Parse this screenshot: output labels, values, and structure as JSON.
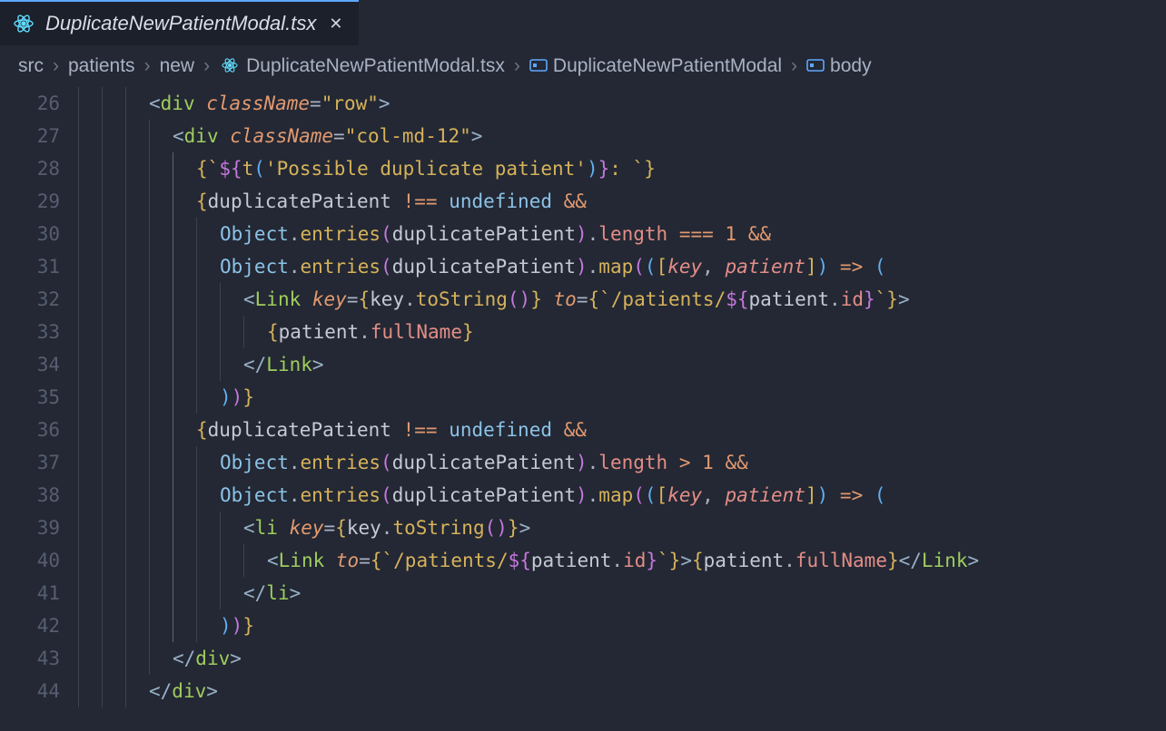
{
  "tab": {
    "title": "DuplicateNewPatientModal.tsx"
  },
  "breadcrumb": {
    "src": "src",
    "patients": "patients",
    "new": "new",
    "file": "DuplicateNewPatientModal.tsx",
    "component": "DuplicateNewPatientModal",
    "symbol": "body"
  },
  "gutter": {
    "start": 26,
    "end": 44
  },
  "code": {
    "lines": [
      {
        "n": 26,
        "indent": 3,
        "tokens": [
          {
            "t": "<",
            "c": "tagp"
          },
          {
            "t": "div",
            "c": "tag"
          },
          {
            "t": " "
          },
          {
            "t": "className",
            "c": "attr"
          },
          {
            "t": "=",
            "c": "pun"
          },
          {
            "t": "\"row\"",
            "c": "str"
          },
          {
            "t": ">",
            "c": "tagp"
          }
        ]
      },
      {
        "n": 27,
        "indent": 4,
        "tokens": [
          {
            "t": "<",
            "c": "tagp"
          },
          {
            "t": "div",
            "c": "tag"
          },
          {
            "t": " "
          },
          {
            "t": "className",
            "c": "attr"
          },
          {
            "t": "=",
            "c": "pun"
          },
          {
            "t": "\"col-md-12\"",
            "c": "str"
          },
          {
            "t": ">",
            "c": "tagp"
          }
        ]
      },
      {
        "n": 28,
        "indent": 5,
        "tokens": [
          {
            "t": "{",
            "c": "brace-y"
          },
          {
            "t": "`",
            "c": "tick"
          },
          {
            "t": "${",
            "c": "brace-p"
          },
          {
            "t": "t",
            "c": "call"
          },
          {
            "t": "(",
            "c": "brace-b"
          },
          {
            "t": "'Possible duplicate patient'",
            "c": "str"
          },
          {
            "t": ")",
            "c": "brace-b"
          },
          {
            "t": "}",
            "c": "brace-p"
          },
          {
            "t": ": ",
            "c": "str"
          },
          {
            "t": "`",
            "c": "tick"
          },
          {
            "t": "}",
            "c": "brace-y"
          }
        ]
      },
      {
        "n": 29,
        "indent": 5,
        "tokens": [
          {
            "t": "{",
            "c": "brace-y"
          },
          {
            "t": "duplicatePatient",
            "c": "var"
          },
          {
            "t": " "
          },
          {
            "t": "!==",
            "c": "op"
          },
          {
            "t": " "
          },
          {
            "t": "undefined",
            "c": "kw"
          },
          {
            "t": " "
          },
          {
            "t": "&&",
            "c": "op"
          }
        ]
      },
      {
        "n": 30,
        "indent": 6,
        "tokens": [
          {
            "t": "Object",
            "c": "obj"
          },
          {
            "t": ".",
            "c": "pun"
          },
          {
            "t": "entries",
            "c": "call"
          },
          {
            "t": "(",
            "c": "brace-p"
          },
          {
            "t": "duplicatePatient",
            "c": "var"
          },
          {
            "t": ")",
            "c": "brace-p"
          },
          {
            "t": ".",
            "c": "pun"
          },
          {
            "t": "length",
            "c": "prop"
          },
          {
            "t": " "
          },
          {
            "t": "===",
            "c": "op"
          },
          {
            "t": " "
          },
          {
            "t": "1",
            "c": "num"
          },
          {
            "t": " "
          },
          {
            "t": "&&",
            "c": "op"
          }
        ]
      },
      {
        "n": 31,
        "indent": 6,
        "tokens": [
          {
            "t": "Object",
            "c": "obj"
          },
          {
            "t": ".",
            "c": "pun"
          },
          {
            "t": "entries",
            "c": "call"
          },
          {
            "t": "(",
            "c": "brace-p"
          },
          {
            "t": "duplicatePatient",
            "c": "var"
          },
          {
            "t": ")",
            "c": "brace-p"
          },
          {
            "t": ".",
            "c": "pun"
          },
          {
            "t": "map",
            "c": "call"
          },
          {
            "t": "(",
            "c": "brace-p"
          },
          {
            "t": "(",
            "c": "brace-b"
          },
          {
            "t": "[",
            "c": "brace-y"
          },
          {
            "t": "key",
            "c": "param"
          },
          {
            "t": ", ",
            "c": "pun"
          },
          {
            "t": "patient",
            "c": "param"
          },
          {
            "t": "]",
            "c": "brace-y"
          },
          {
            "t": ")",
            "c": "brace-b"
          },
          {
            "t": " "
          },
          {
            "t": "=>",
            "c": "arrow"
          },
          {
            "t": " "
          },
          {
            "t": "(",
            "c": "brace-b"
          }
        ]
      },
      {
        "n": 32,
        "indent": 7,
        "tokens": [
          {
            "t": "<",
            "c": "tagp"
          },
          {
            "t": "Link",
            "c": "tag"
          },
          {
            "t": " "
          },
          {
            "t": "key",
            "c": "attr"
          },
          {
            "t": "=",
            "c": "pun"
          },
          {
            "t": "{",
            "c": "brace-y"
          },
          {
            "t": "key",
            "c": "var"
          },
          {
            "t": ".",
            "c": "pun"
          },
          {
            "t": "toString",
            "c": "call"
          },
          {
            "t": "(",
            "c": "brace-p"
          },
          {
            "t": ")",
            "c": "brace-p"
          },
          {
            "t": "}",
            "c": "brace-y"
          },
          {
            "t": " "
          },
          {
            "t": "to",
            "c": "attr"
          },
          {
            "t": "=",
            "c": "pun"
          },
          {
            "t": "{",
            "c": "brace-y"
          },
          {
            "t": "`",
            "c": "tick"
          },
          {
            "t": "/patients/",
            "c": "str"
          },
          {
            "t": "${",
            "c": "brace-p"
          },
          {
            "t": "patient",
            "c": "var"
          },
          {
            "t": ".",
            "c": "pun"
          },
          {
            "t": "id",
            "c": "prop"
          },
          {
            "t": "}",
            "c": "brace-p"
          },
          {
            "t": "`",
            "c": "tick"
          },
          {
            "t": "}",
            "c": "brace-y"
          },
          {
            "t": ">",
            "c": "tagp"
          }
        ]
      },
      {
        "n": 33,
        "indent": 8,
        "tokens": [
          {
            "t": "{",
            "c": "brace-y"
          },
          {
            "t": "patient",
            "c": "var"
          },
          {
            "t": ".",
            "c": "pun"
          },
          {
            "t": "fullName",
            "c": "prop"
          },
          {
            "t": "}",
            "c": "brace-y"
          }
        ]
      },
      {
        "n": 34,
        "indent": 7,
        "tokens": [
          {
            "t": "</",
            "c": "tagp"
          },
          {
            "t": "Link",
            "c": "tag"
          },
          {
            "t": ">",
            "c": "tagp"
          }
        ]
      },
      {
        "n": 35,
        "indent": 6,
        "tokens": [
          {
            "t": ")",
            "c": "brace-b"
          },
          {
            "t": ")",
            "c": "brace-p"
          },
          {
            "t": "}",
            "c": "brace-y"
          }
        ]
      },
      {
        "n": 36,
        "indent": 5,
        "tokens": [
          {
            "t": "{",
            "c": "brace-y"
          },
          {
            "t": "duplicatePatient",
            "c": "var"
          },
          {
            "t": " "
          },
          {
            "t": "!==",
            "c": "op"
          },
          {
            "t": " "
          },
          {
            "t": "undefined",
            "c": "kw"
          },
          {
            "t": " "
          },
          {
            "t": "&&",
            "c": "op"
          }
        ]
      },
      {
        "n": 37,
        "indent": 6,
        "tokens": [
          {
            "t": "Object",
            "c": "obj"
          },
          {
            "t": ".",
            "c": "pun"
          },
          {
            "t": "entries",
            "c": "call"
          },
          {
            "t": "(",
            "c": "brace-p"
          },
          {
            "t": "duplicatePatient",
            "c": "var"
          },
          {
            "t": ")",
            "c": "brace-p"
          },
          {
            "t": ".",
            "c": "pun"
          },
          {
            "t": "length",
            "c": "prop"
          },
          {
            "t": " "
          },
          {
            "t": ">",
            "c": "op"
          },
          {
            "t": " "
          },
          {
            "t": "1",
            "c": "num"
          },
          {
            "t": " "
          },
          {
            "t": "&&",
            "c": "op"
          }
        ]
      },
      {
        "n": 38,
        "indent": 6,
        "tokens": [
          {
            "t": "Object",
            "c": "obj"
          },
          {
            "t": ".",
            "c": "pun"
          },
          {
            "t": "entries",
            "c": "call"
          },
          {
            "t": "(",
            "c": "brace-p"
          },
          {
            "t": "duplicatePatient",
            "c": "var"
          },
          {
            "t": ")",
            "c": "brace-p"
          },
          {
            "t": ".",
            "c": "pun"
          },
          {
            "t": "map",
            "c": "call"
          },
          {
            "t": "(",
            "c": "brace-p"
          },
          {
            "t": "(",
            "c": "brace-b"
          },
          {
            "t": "[",
            "c": "brace-y"
          },
          {
            "t": "key",
            "c": "param"
          },
          {
            "t": ", ",
            "c": "pun"
          },
          {
            "t": "patient",
            "c": "param"
          },
          {
            "t": "]",
            "c": "brace-y"
          },
          {
            "t": ")",
            "c": "brace-b"
          },
          {
            "t": " "
          },
          {
            "t": "=>",
            "c": "arrow"
          },
          {
            "t": " "
          },
          {
            "t": "(",
            "c": "brace-b"
          }
        ]
      },
      {
        "n": 39,
        "indent": 7,
        "tokens": [
          {
            "t": "<",
            "c": "tagp"
          },
          {
            "t": "li",
            "c": "tag"
          },
          {
            "t": " "
          },
          {
            "t": "key",
            "c": "attr"
          },
          {
            "t": "=",
            "c": "pun"
          },
          {
            "t": "{",
            "c": "brace-y"
          },
          {
            "t": "key",
            "c": "var"
          },
          {
            "t": ".",
            "c": "pun"
          },
          {
            "t": "toString",
            "c": "call"
          },
          {
            "t": "(",
            "c": "brace-p"
          },
          {
            "t": ")",
            "c": "brace-p"
          },
          {
            "t": "}",
            "c": "brace-y"
          },
          {
            "t": ">",
            "c": "tagp"
          }
        ]
      },
      {
        "n": 40,
        "indent": 8,
        "tokens": [
          {
            "t": "<",
            "c": "tagp"
          },
          {
            "t": "Link",
            "c": "tag"
          },
          {
            "t": " "
          },
          {
            "t": "to",
            "c": "attr"
          },
          {
            "t": "=",
            "c": "pun"
          },
          {
            "t": "{",
            "c": "brace-y"
          },
          {
            "t": "`",
            "c": "tick"
          },
          {
            "t": "/patients/",
            "c": "str"
          },
          {
            "t": "${",
            "c": "brace-p"
          },
          {
            "t": "patient",
            "c": "var"
          },
          {
            "t": ".",
            "c": "pun"
          },
          {
            "t": "id",
            "c": "prop"
          },
          {
            "t": "}",
            "c": "brace-p"
          },
          {
            "t": "`",
            "c": "tick"
          },
          {
            "t": "}",
            "c": "brace-y"
          },
          {
            "t": ">",
            "c": "tagp"
          },
          {
            "t": "{",
            "c": "brace-y"
          },
          {
            "t": "patient",
            "c": "var"
          },
          {
            "t": ".",
            "c": "pun"
          },
          {
            "t": "fullName",
            "c": "prop"
          },
          {
            "t": "}",
            "c": "brace-y"
          },
          {
            "t": "</",
            "c": "tagp"
          },
          {
            "t": "Link",
            "c": "tag"
          },
          {
            "t": ">",
            "c": "tagp"
          }
        ]
      },
      {
        "n": 41,
        "indent": 7,
        "tokens": [
          {
            "t": "</",
            "c": "tagp"
          },
          {
            "t": "li",
            "c": "tag"
          },
          {
            "t": ">",
            "c": "tagp"
          }
        ]
      },
      {
        "n": 42,
        "indent": 6,
        "tokens": [
          {
            "t": ")",
            "c": "brace-b"
          },
          {
            "t": ")",
            "c": "brace-p"
          },
          {
            "t": "}",
            "c": "brace-y"
          }
        ]
      },
      {
        "n": 43,
        "indent": 4,
        "tokens": [
          {
            "t": "</",
            "c": "tagp"
          },
          {
            "t": "div",
            "c": "tag"
          },
          {
            "t": ">",
            "c": "tagp"
          }
        ]
      },
      {
        "n": 44,
        "indent": 3,
        "tokens": [
          {
            "t": "</",
            "c": "tagp"
          },
          {
            "t": "div",
            "c": "tag"
          },
          {
            "t": ">",
            "c": "tagp"
          }
        ]
      }
    ]
  }
}
